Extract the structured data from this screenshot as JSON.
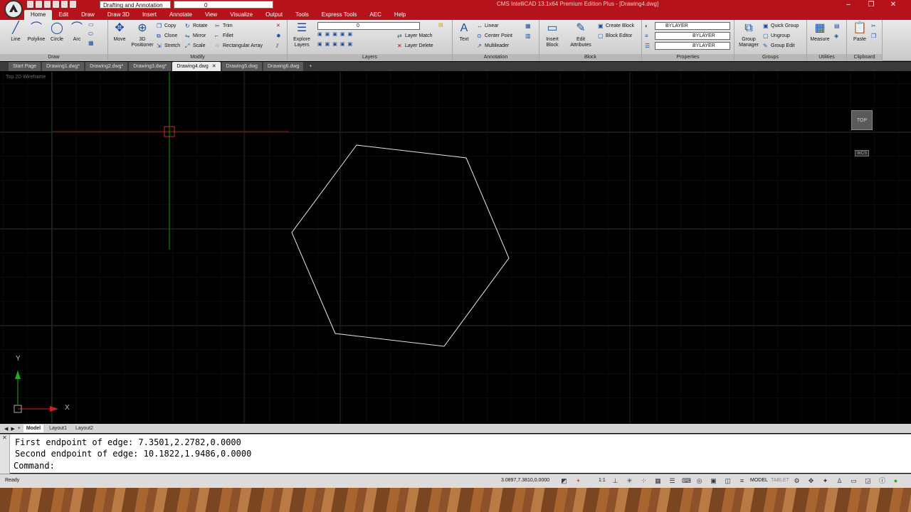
{
  "titlebar": {
    "workspace": "Drafting and Annotation",
    "layer_value": "0",
    "title": "CMS IntelliCAD 13.1x64 Premium Edition Plus - [Drawing4.dwg]",
    "controls": [
      "–",
      "❐",
      "✕"
    ]
  },
  "menu": [
    "Home",
    "Edit",
    "Draw",
    "Draw 3D",
    "Insert",
    "Annotate",
    "View",
    "Visualize",
    "Output",
    "Tools",
    "Express Tools",
    "AEC",
    "Help"
  ],
  "ribbon": {
    "draw": {
      "title": "Draw",
      "line": "Line",
      "polyline": "Polyline",
      "circle": "Circle",
      "arc": "Arc"
    },
    "modify": {
      "title": "Modify",
      "move": "Move",
      "positioner": "3D Positioner",
      "copy": "Copy",
      "rotate": "Rotate",
      "trim": "Trim",
      "clone": "Clone",
      "mirror": "Mirror",
      "fillet": "Fillet",
      "stretch": "Stretch",
      "scale": "Scale",
      "rect_array": "Rectangular Array"
    },
    "layers": {
      "title": "Layers",
      "explore": "Explore Layers",
      "layer_value": "0",
      "layer_match": "Layer Match",
      "layer_delete": "Layer Delete"
    },
    "annotation": {
      "title": "Annotation",
      "text": "Text",
      "linear": "Linear",
      "center_point": "Center Point",
      "multileader": "Multileader"
    },
    "block": {
      "title": "Block",
      "insert": "Insert Block",
      "edit_attr": "Edit Attributes",
      "create": "Create Block",
      "editor": "Block Editor"
    },
    "properties": {
      "title": "Properties",
      "color": "BYLAYER",
      "linetype": "BYLAYER",
      "lineweight": "BYLAYER"
    },
    "groups": {
      "title": "Groups",
      "manager": "Group Manager",
      "quick": "Quick Group",
      "ungroup": "Ungroup",
      "edit": "Group Edit"
    },
    "utilities": {
      "title": "Utilities",
      "measure": "Measure"
    },
    "clipboard": {
      "title": "Clipboard",
      "paste": "Paste"
    }
  },
  "doc_tabs": [
    {
      "label": "Start Page",
      "active": false
    },
    {
      "label": "Drawing1.dwg*",
      "active": false
    },
    {
      "label": "Drawing2.dwg*",
      "active": false
    },
    {
      "label": "Drawing3.dwg*",
      "active": false
    },
    {
      "label": "Drawing4.dwg",
      "active": true
    },
    {
      "label": "Drawing5.dwg",
      "active": false
    },
    {
      "label": "Drawing6.dwg",
      "active": false
    }
  ],
  "doc_tab_close": "✕",
  "doc_tab_add": "+",
  "viewport": {
    "label": "Top  2D Wireframe",
    "cube": "TOP",
    "wcs": "WCS",
    "ucs_x": "X",
    "ucs_y": "Y"
  },
  "layout_tabs": [
    "Model",
    "Layout1",
    "Layout2"
  ],
  "command": {
    "line1": "First endpoint of edge: 7.3501,2.2782,0.0000",
    "line2": "Second endpoint of edge: 10.1822,1.9486,0.0000",
    "prompt": "Command:"
  },
  "status": {
    "ready": "Ready",
    "coords": "3.0897,7.3810,0.0000",
    "scale": "1:1",
    "model": "MODEL",
    "tablet": "TABLET"
  },
  "colors": {
    "titlebar": "#b5121b",
    "viewport_bg": "#000000",
    "hexagon": "#e6e6e6",
    "ucs_x": "#cc2222",
    "ucs_y": "#22aa22"
  }
}
